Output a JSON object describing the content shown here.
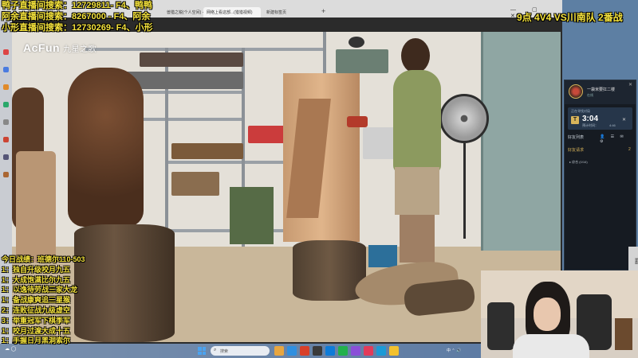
{
  "browser": {
    "tabs": [
      {
        "label": "兽猎之锐(个人空间) - AcFun弹幕视频网",
        "active": false
      },
      {
        "label": "网络上看这部...(猎猎视频)",
        "active": true
      },
      {
        "label": "新建标签页",
        "active": false
      }
    ],
    "new_tab_glyph": "+",
    "window_controls": "— ▢ ✕"
  },
  "video": {
    "logo": "AcFun",
    "logo_sub": "九星之歌"
  },
  "overlay": {
    "search_lines": [
      "鸭子直播间搜索：12729811- F4、鸭鸭",
      "阿余直播间搜索：8267000 - F4、阿余",
      "小形直播间搜索：12730269- F4、小形"
    ],
    "match_title": "9点 4V4 VS川南队 2番战",
    "record_title": "今日战绩：班德尔110-503",
    "records": [
      "1：独自升级咬月九五",
      "1：大成饱满比尔九五",
      "1：以逸待劳战三家大龙",
      "1：备战康爽追三星猴",
      "2：连败征战九级虚空",
      "3：举重冠军下棋季军",
      "1：咬月过渡大成十五",
      "1：手握日月黑洞索尔"
    ]
  },
  "side_panel": {
    "name": "一袋米要扛二楼",
    "sub": "在线",
    "close_glyph": "✕",
    "queue_label": "正在寻找对局",
    "queue_icon": "T",
    "queue_time": "3:04",
    "queue_est_label": "预计时间：",
    "queue_est_value": "4:46",
    "queue_cancel": "✕",
    "friends_label": "好友列表",
    "friends_icons": "👤 ☰ ✉ ⚙",
    "friend_requests_label": "好友请求",
    "friend_requests_count": "2",
    "friend_group": "▸ 综合 (0/16)",
    "side_tag": "弹幕"
  },
  "taskbar": {
    "search_placeholder": "搜索",
    "search_glyph": "⌕",
    "tray_text": "中 ⌃ 🔊",
    "left_tray": "☁ ◯"
  },
  "colors": {
    "overlay_text": "#f5e33c",
    "accent_gold": "#d8b45a"
  }
}
